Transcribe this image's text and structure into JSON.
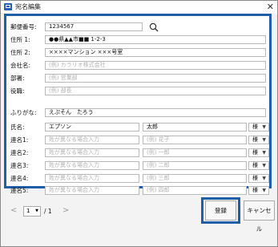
{
  "window": {
    "title": "宛名編集",
    "close_glyph": "✕"
  },
  "form": {
    "postal": {
      "label": "郵便番号:",
      "value": "1234567"
    },
    "address1": {
      "label": "住所 1:",
      "value": "●●県▲▲市■■ 1-2-3"
    },
    "address2": {
      "label": "住所 2:",
      "value": "××××マンション ×××号室"
    },
    "company": {
      "label": "会社名:",
      "placeholder": "(例) カラリオ株式会社"
    },
    "department": {
      "label": "部署:",
      "placeholder": "(例) 営業部"
    },
    "position": {
      "label": "役職:",
      "placeholder": "(例) 部長"
    },
    "furigana": {
      "label": "ふりがな:",
      "value": "えぷそん　たろう"
    },
    "name": {
      "label": "氏名:",
      "last": "エプソン",
      "first": "太郎",
      "honorific": "様"
    },
    "joint_names": [
      {
        "label": "連名1:",
        "last_placeholder": "姓が異なる場合入力",
        "first_placeholder": "(例) 花子",
        "honorific": "様"
      },
      {
        "label": "連名2:",
        "last_placeholder": "姓が異なる場合入力",
        "first_placeholder": "(例) 一郎",
        "honorific": "様"
      },
      {
        "label": "連名3:",
        "last_placeholder": "姓が異なる場合入力",
        "first_placeholder": "(例) 二郎",
        "honorific": "様"
      },
      {
        "label": "連名4:",
        "last_placeholder": "姓が異なる場合入力",
        "first_placeholder": "(例) 三郎",
        "honorific": "様"
      },
      {
        "label": "連名5:",
        "last_placeholder": "姓が異なる場合入力",
        "first_placeholder": "(例) 四郎",
        "honorific": "様"
      }
    ]
  },
  "pager": {
    "prev": "<",
    "page": "1",
    "separator_total": "/ 1",
    "next": ">"
  },
  "buttons": {
    "register": "登録",
    "cancel": "キャンセル"
  },
  "colors": {
    "focus_border": "#1f5ea8",
    "placeholder": "#b2b2b2"
  }
}
